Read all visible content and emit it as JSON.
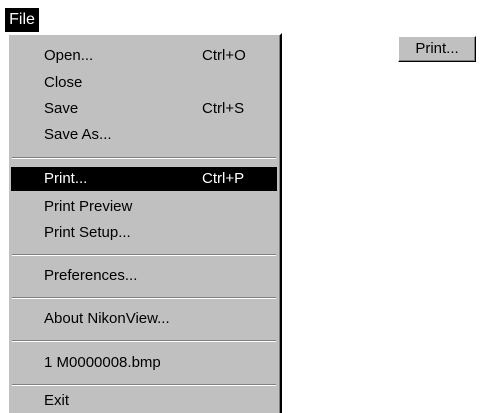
{
  "menubar": {
    "file_label": "File"
  },
  "menu": {
    "items": [
      {
        "label": "Open...",
        "shortcut": "Ctrl+O"
      },
      {
        "label": "Close",
        "shortcut": ""
      },
      {
        "label": "Save",
        "shortcut": "Ctrl+S"
      },
      {
        "label": "Save As...",
        "shortcut": ""
      },
      {
        "label": "Print...",
        "shortcut": "Ctrl+P",
        "highlighted": true
      },
      {
        "label": "Print Preview",
        "shortcut": ""
      },
      {
        "label": "Print Setup...",
        "shortcut": ""
      },
      {
        "label": "Preferences...",
        "shortcut": ""
      },
      {
        "label": "About NikonView...",
        "shortcut": ""
      },
      {
        "label": "1 M0000008.bmp",
        "shortcut": ""
      },
      {
        "label": "Exit",
        "shortcut": ""
      }
    ]
  },
  "toolbar": {
    "print_button_label": "Print..."
  },
  "colors": {
    "menu_background": "#c0c0c0",
    "highlight_background": "#000000",
    "highlight_text": "#ffffff"
  }
}
